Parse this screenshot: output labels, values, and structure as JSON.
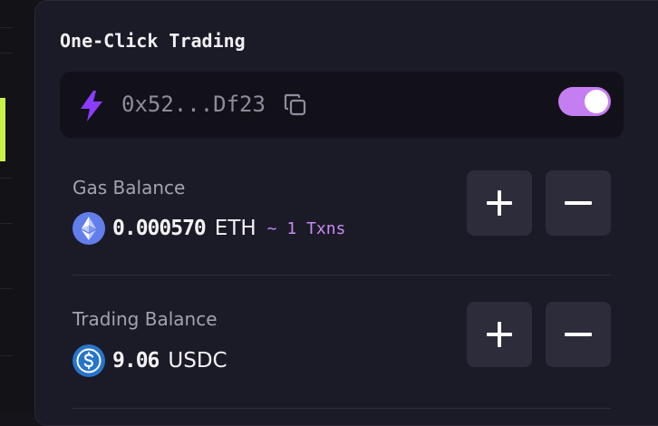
{
  "panel": {
    "title": "One-Click Trading"
  },
  "wallet": {
    "address": "0x52...Df23",
    "one_click_enabled": true
  },
  "gas_balance": {
    "label": "Gas Balance",
    "amount": "0.000570",
    "unit": "ETH",
    "tx_estimate": "~ 1 Txns",
    "coin_icon": "ethereum-icon"
  },
  "trading_balance": {
    "label": "Trading Balance",
    "amount": "9.06",
    "unit": "USDC",
    "coin_icon": "usdc-icon"
  },
  "colors": {
    "accent_purple": "#c57ef2",
    "bolt_purple": "#8b3dff",
    "panel_bg": "#1b1a27",
    "button_bg": "#2d2c3a",
    "side_accent": "#c6f24a"
  }
}
